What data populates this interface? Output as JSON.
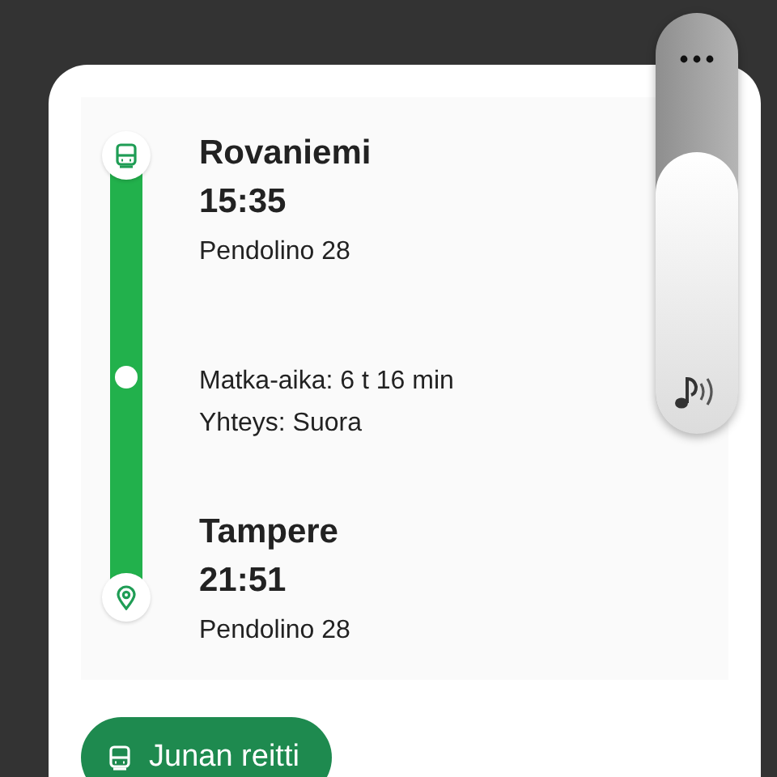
{
  "stops": [
    {
      "kind": "origin",
      "station": "Rovaniemi",
      "time": "15:35",
      "train": "Pendolino 28"
    },
    {
      "kind": "destination",
      "station": "Tampere",
      "time": "21:51",
      "train": "Pendolino 28"
    }
  ],
  "journey": {
    "duration": "Matka-aika: 6 t 16 min",
    "connection": "Yhteys: Suora"
  },
  "route_button": {
    "label": "Junan reitti"
  },
  "volume": {
    "level": 0.67
  }
}
